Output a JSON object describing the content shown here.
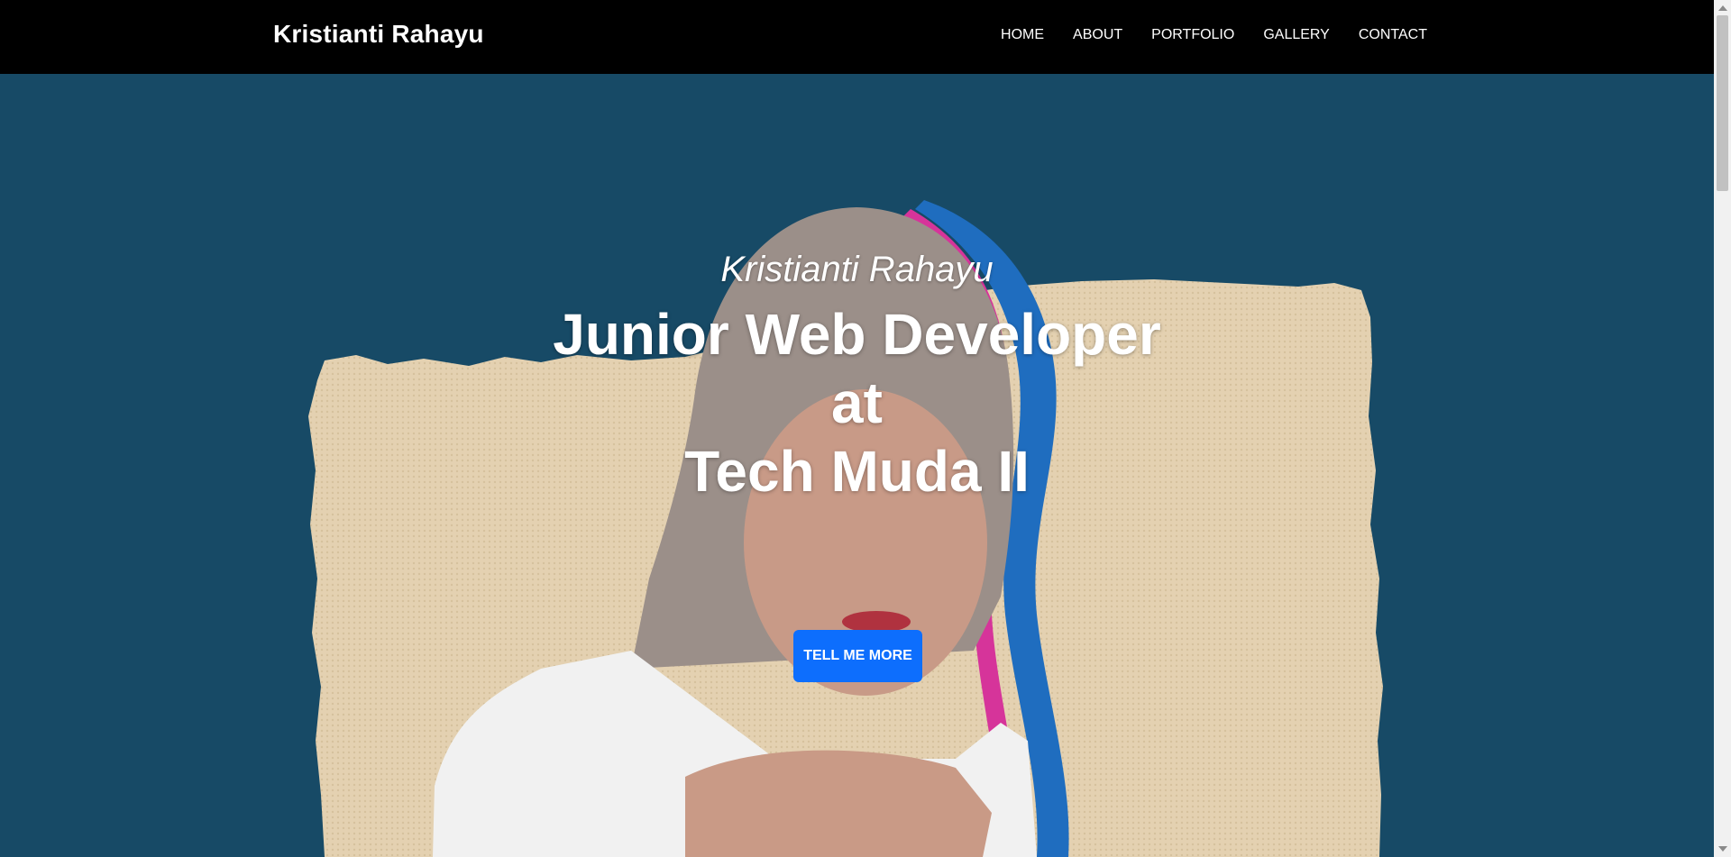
{
  "navbar": {
    "brand": "Kristianti Rahayu",
    "links": [
      {
        "label": "HOME"
      },
      {
        "label": "ABOUT"
      },
      {
        "label": "PORTFOLIO"
      },
      {
        "label": "GALLERY"
      },
      {
        "label": "CONTACT"
      }
    ]
  },
  "hero": {
    "subtitle": "Kristianti Rahayu",
    "title_line1": "Junior Web Developer",
    "title_line2": "at",
    "title_line3": "Tech Muda II",
    "cta_label": "TELL ME MORE"
  },
  "colors": {
    "navbar_bg": "#000000",
    "hero_bg": "#174a66",
    "button_bg": "#0d6efd",
    "paper": "#e6d3b3"
  }
}
